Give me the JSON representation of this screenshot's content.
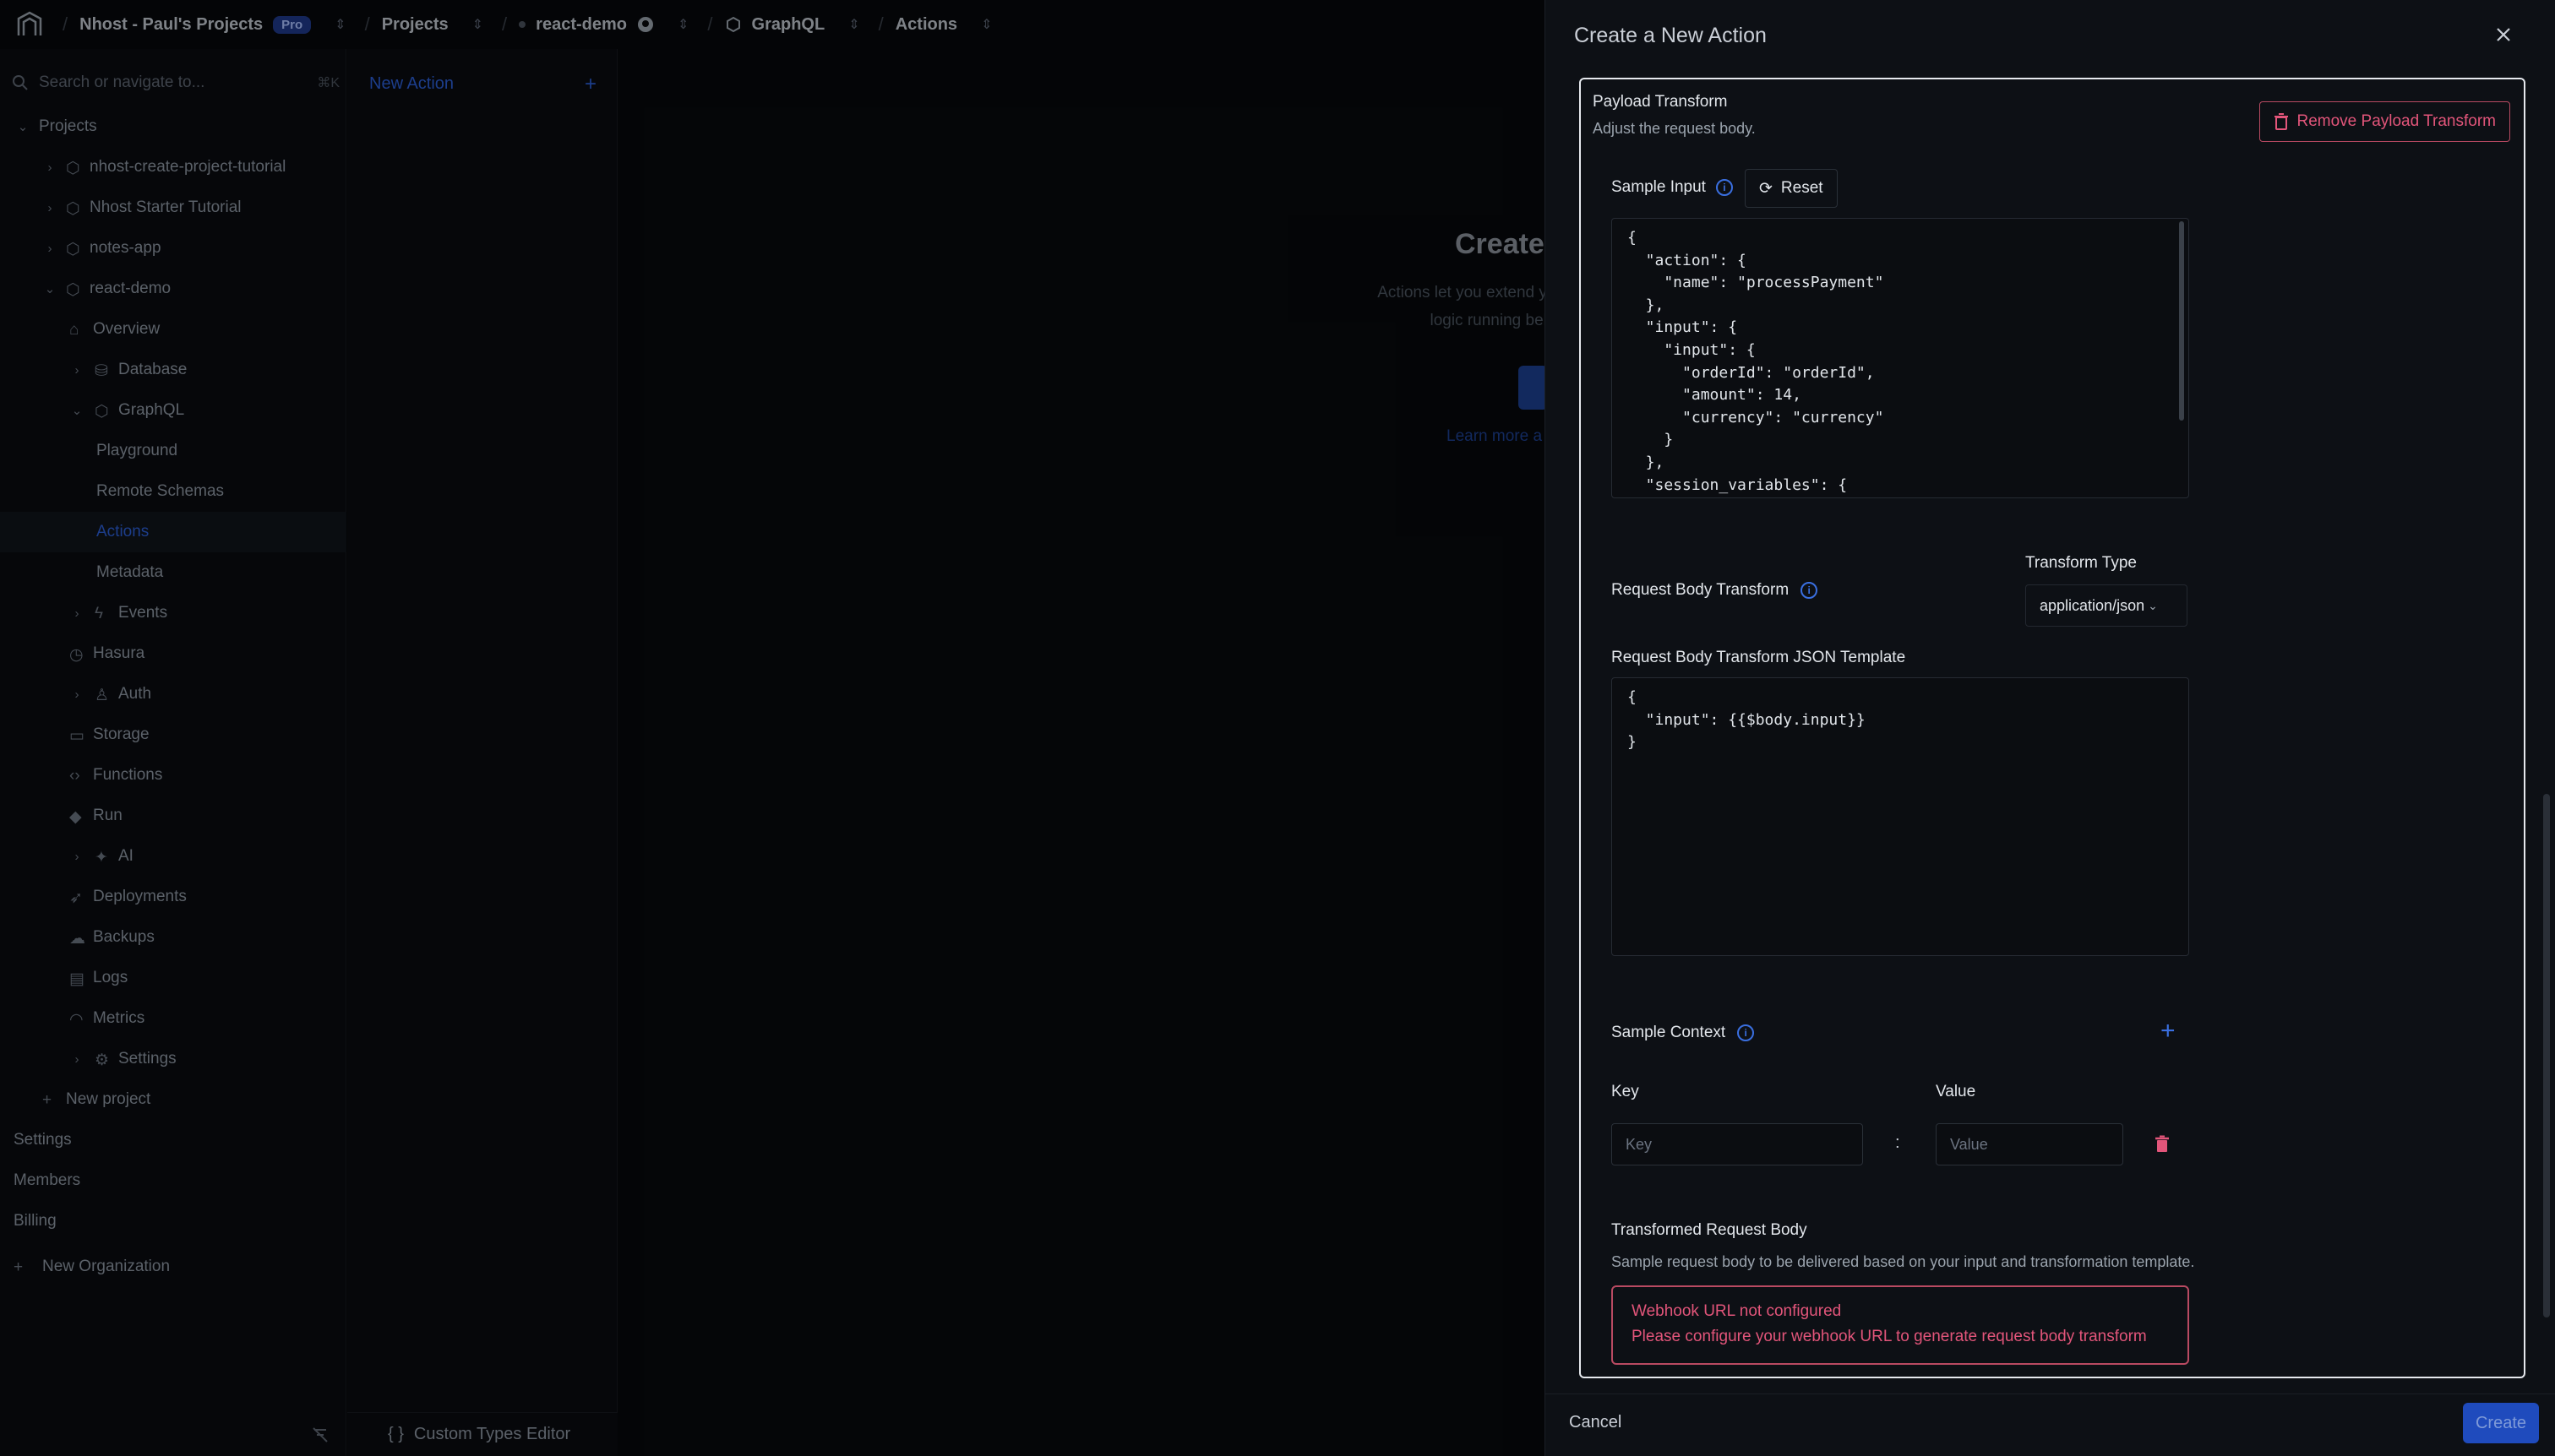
{
  "topbar": {
    "org": "Nhost - Paul's Projects",
    "plan_badge": "Pro",
    "projects": "Projects",
    "project": "react-demo",
    "section": "GraphQL",
    "page": "Actions"
  },
  "sidebar": {
    "search_placeholder": "Search or navigate to...",
    "search_shortcut": "⌘K",
    "projects_label": "Projects",
    "items": [
      {
        "label": "nhost-create-project-tutorial"
      },
      {
        "label": "Nhost Starter Tutorial"
      },
      {
        "label": "notes-app"
      },
      {
        "label": "react-demo"
      },
      {
        "label": "Overview"
      },
      {
        "label": "Database"
      },
      {
        "label": "GraphQL"
      },
      {
        "label": "Playground"
      },
      {
        "label": "Remote Schemas"
      },
      {
        "label": "Actions"
      },
      {
        "label": "Metadata"
      },
      {
        "label": "Events"
      },
      {
        "label": "Hasura"
      },
      {
        "label": "Auth"
      },
      {
        "label": "Storage"
      },
      {
        "label": "Functions"
      },
      {
        "label": "Run"
      },
      {
        "label": "AI"
      },
      {
        "label": "Deployments"
      },
      {
        "label": "Backups"
      },
      {
        "label": "Logs"
      },
      {
        "label": "Metrics"
      },
      {
        "label": "Settings"
      },
      {
        "label": "New project"
      }
    ],
    "org_items": [
      {
        "label": "Settings"
      },
      {
        "label": "Members"
      },
      {
        "label": "Billing"
      },
      {
        "label": "New Organization"
      }
    ]
  },
  "subnav": {
    "new_action": "New Action",
    "custom_types": "Custom Types Editor"
  },
  "main": {
    "title": "Create y",
    "desc_line1": "Actions let you extend you",
    "desc_line2": "logic running behin",
    "learn_more": "Learn more a"
  },
  "drawer": {
    "title": "Create a New Action",
    "payload_title": "Payload Transform",
    "payload_desc": "Adjust the request body.",
    "remove_label": "Remove Payload Transform",
    "sample_input_label": "Sample Input",
    "reset_label": "Reset",
    "sample_input_code": "{\n  \"action\": {\n    \"name\": \"processPayment\"\n  },\n  \"input\": {\n    \"input\": {\n      \"orderId\": \"orderId\",\n      \"amount\": 14,\n      \"currency\": \"currency\"\n    }\n  },\n  \"session_variables\": {",
    "request_body_label": "Request Body Transform",
    "transform_type_label": "Transform Type",
    "transform_type_value": "application/json",
    "template_label": "Request Body Transform JSON Template",
    "template_code": "{\n  \"input\": {{$body.input}}\n}",
    "sample_context_label": "Sample Context",
    "key_label": "Key",
    "value_label": "Value",
    "key_placeholder": "Key",
    "value_placeholder": "Value",
    "separator": ":",
    "transformed_label": "Transformed Request Body",
    "transformed_desc": "Sample request body to be delivered based on your input and transformation template.",
    "error_title": "Webhook URL not configured",
    "error_desc": "Please configure your webhook URL to generate request body transform",
    "cancel": "Cancel",
    "create": "Create"
  }
}
